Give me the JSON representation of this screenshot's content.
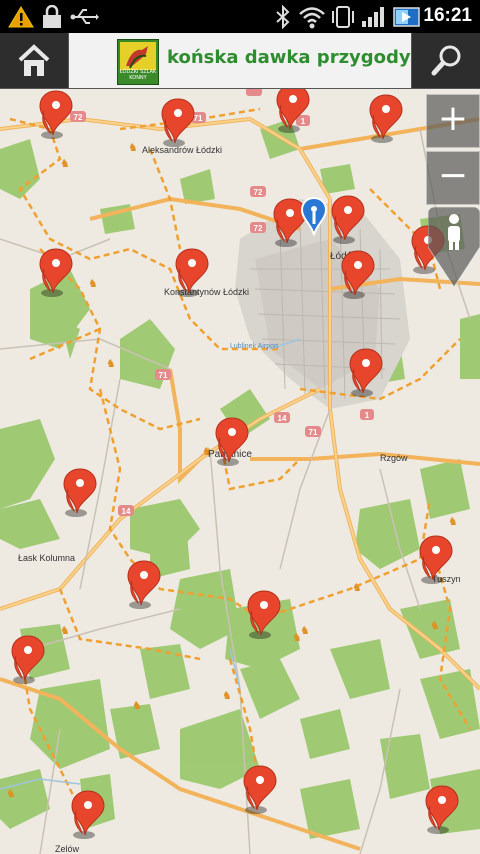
{
  "status": {
    "time": "16:21",
    "icons": [
      "warning-icon",
      "lock-icon",
      "usb-icon",
      "bluetooth-icon",
      "wifi-icon",
      "vibrate-icon",
      "signal-icon",
      "battery-icon"
    ]
  },
  "appbar": {
    "title": "końska dawka przygody",
    "logo_text": "ŁÓDZKI SZLAK KONNY",
    "home_icon": "home-icon",
    "search_icon": "search-icon"
  },
  "map": {
    "zoom_in": "+",
    "zoom_out": "−",
    "places": [
      "Aleksandrów Łódzki",
      "Konstantynów Łódzki",
      "Łódź",
      "Pabianice",
      "Rzgów",
      "Łask Kolumna",
      "Tuszyn",
      "Zelów",
      "Lublinek Airport"
    ],
    "road_numbers": [
      "72",
      "71",
      "72",
      "72",
      "14",
      "71",
      "1",
      "1",
      "14",
      "71"
    ],
    "markers_count": 22
  }
}
